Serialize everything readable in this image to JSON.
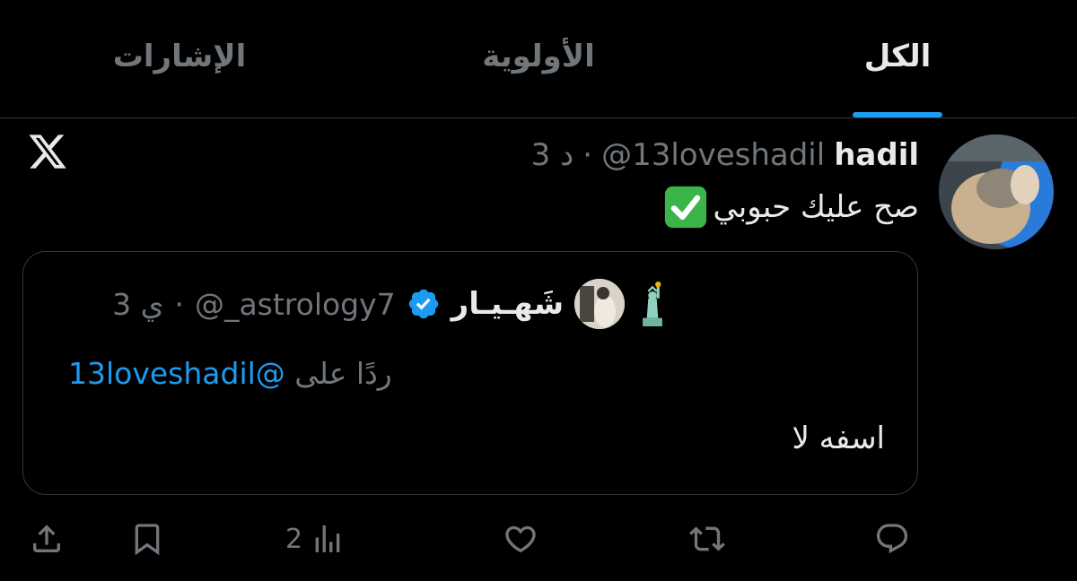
{
  "tabs": [
    {
      "label": "الكل",
      "active": true
    },
    {
      "label": "الأولوية",
      "active": false
    },
    {
      "label": "الإشارات",
      "active": false
    }
  ],
  "tweet": {
    "author_name": "hadil",
    "author_handle": "@13loveshadil",
    "separator": "·",
    "time": "3 د",
    "text": "صح عليك حبوبي",
    "emoji": "check-mark-button-emoji",
    "source_icon": "x-logo-icon"
  },
  "quote": {
    "author_name": "شَهـيـار",
    "verified": true,
    "author_handle": "@_astrology7",
    "separator": "·",
    "time": "3 ي",
    "name_emoji": "statue-of-liberty-emoji",
    "reply_prefix": "ردًا على",
    "reply_mention": "@13loveshadil",
    "text": "اسفه لا"
  },
  "actions": {
    "reply_icon": "reply-icon",
    "retweet_icon": "retweet-icon",
    "like_icon": "like-icon",
    "views_icon": "views-icon",
    "views_count": "2",
    "bookmark_icon": "bookmark-icon",
    "share_icon": "share-icon"
  },
  "colors": {
    "background": "#000000",
    "accent": "#1d9bf0",
    "text_primary": "#e7e9ea",
    "text_secondary": "#71767b",
    "border": "#2f3336"
  }
}
